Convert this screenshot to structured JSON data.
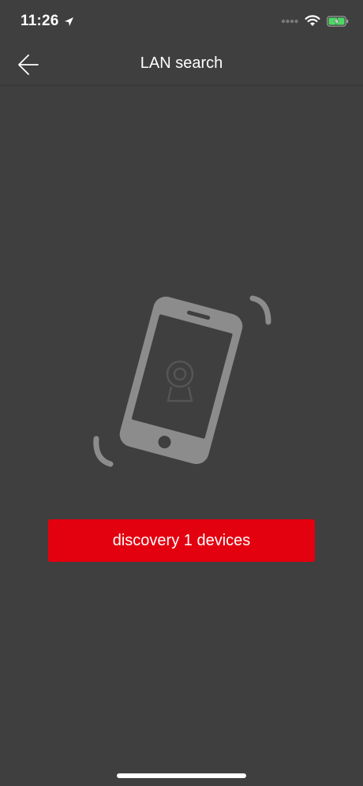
{
  "status_bar": {
    "time": "11:26",
    "location_icon": "location-arrow-icon",
    "signal_icon": "cellular-signal-icon",
    "wifi_icon": "wifi-icon",
    "battery_icon": "battery-charging-icon",
    "battery_color": "#4cd964"
  },
  "nav": {
    "back_icon": "back-arrow-icon",
    "title": "LAN search"
  },
  "illustration": {
    "icon": "phone-shake-camera-icon"
  },
  "discovery_button": {
    "label": "discovery 1 devices",
    "color": "#e3000f"
  },
  "colors": {
    "background": "#3f3f3f",
    "illustration": "#8c8c8c"
  }
}
